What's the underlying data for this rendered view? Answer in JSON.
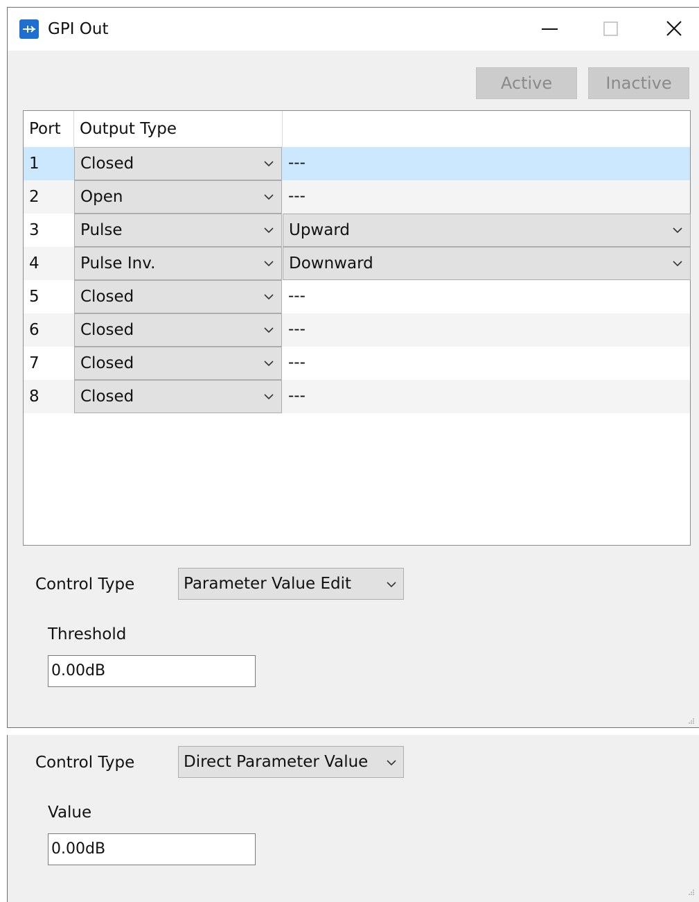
{
  "window": {
    "title": "GPI Out",
    "app_icon": "gpi-plugin-icon",
    "controls": {
      "minimize": "minimize-icon",
      "maximize": "maximize-icon",
      "close": "close-icon"
    }
  },
  "toolbar": {
    "active_label": "Active",
    "inactive_label": "Inactive"
  },
  "grid": {
    "headers": {
      "port": "Port",
      "output_type": "Output Type"
    },
    "rows": [
      {
        "port": "1",
        "output_type": "Closed",
        "direction": "---"
      },
      {
        "port": "2",
        "output_type": "Open",
        "direction": "---"
      },
      {
        "port": "3",
        "output_type": "Pulse",
        "direction": "Upward"
      },
      {
        "port": "4",
        "output_type": "Pulse Inv.",
        "direction": "Downward"
      },
      {
        "port": "5",
        "output_type": "Closed",
        "direction": "---"
      },
      {
        "port": "6",
        "output_type": "Closed",
        "direction": "---"
      },
      {
        "port": "7",
        "output_type": "Closed",
        "direction": "---"
      },
      {
        "port": "8",
        "output_type": "Closed",
        "direction": "---"
      }
    ]
  },
  "control": {
    "label": "Control Type",
    "value": "Parameter Value Edit",
    "threshold_label": "Threshold",
    "threshold_value": "0.00dB"
  },
  "alt_panel": {
    "control_label": "Control Type",
    "control_value": "Direct Parameter Value",
    "value_label": "Value",
    "value_value": "0.00dB"
  },
  "colors": {
    "selected_row": "#cce8ff",
    "window_bg": "#f0f0f0",
    "accent": "#1e6fd0",
    "disabled_button": "#cccccc"
  }
}
